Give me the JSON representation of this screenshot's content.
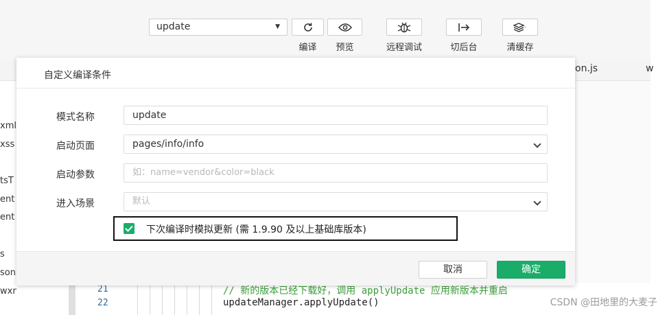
{
  "toolbar": {
    "mode_select": {
      "value": "update"
    },
    "compile": {
      "label": "编译",
      "icon": "refresh-icon"
    },
    "preview": {
      "label": "预览",
      "icon": "eye-icon"
    },
    "remote_debug": {
      "label": "远程调试",
      "icon": "bug-icon"
    },
    "background": {
      "label": "切后台",
      "icon": "switch-background-icon"
    },
    "clear_cache": {
      "label": "清缓存",
      "icon": "layers-icon"
    }
  },
  "tabs": {
    "visible_fragment": "on.js",
    "second_fragment": "w"
  },
  "file_list": [
    "xml",
    "xss",
    "tsT",
    "ent",
    "ent",
    "s",
    "son",
    "wxml"
  ],
  "dialog": {
    "title": "自定义编译条件",
    "fields": [
      {
        "label": "模式名称",
        "value": "update",
        "placeholder": ""
      },
      {
        "label": "启动页面",
        "value": "pages/info/info",
        "placeholder": ""
      },
      {
        "label": "启动参数",
        "value": "",
        "placeholder": "如：name=vendor&color=black"
      },
      {
        "label": "进入场景",
        "value": "",
        "placeholder": "默认"
      }
    ],
    "simulate_update": {
      "checked": true,
      "label": "下次编译时模拟更新 (需 1.9.90 及以上基础库版本)"
    },
    "buttons": {
      "cancel": "取消",
      "ok": "确定"
    }
  },
  "code": {
    "lines": [
      {
        "num": "21",
        "text": "// 新的版本已经下载好，调用 applyUpdate 应用新版本并重启"
      },
      {
        "num": "22",
        "text": "updateManager.applyUpdate()"
      }
    ]
  },
  "watermark": "CSDN @田地里的大麦子",
  "colors": {
    "accent_green": "#1aad6a",
    "comment_green": "#3a9e3a",
    "line_number_blue": "#2a6f9e"
  }
}
